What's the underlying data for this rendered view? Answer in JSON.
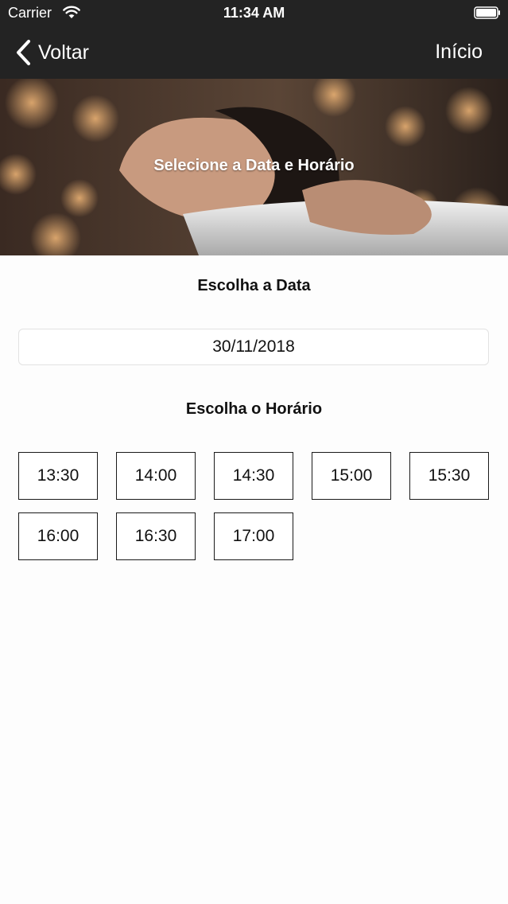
{
  "status_bar": {
    "carrier": "Carrier",
    "time": "11:34 AM"
  },
  "nav": {
    "back_label": "Voltar",
    "home_label": "Início"
  },
  "hero": {
    "title": "Selecione a Data e Horário"
  },
  "date_section": {
    "title": "Escolha a Data",
    "value": "30/11/2018"
  },
  "time_section": {
    "title": "Escolha o Horário",
    "slots": [
      "13:30",
      "14:00",
      "14:30",
      "15:00",
      "15:30",
      "16:00",
      "16:30",
      "17:00"
    ]
  },
  "colors": {
    "top_bar": "#232323",
    "background": "#fdfdfd",
    "slot_border": "#1a1a1a"
  }
}
